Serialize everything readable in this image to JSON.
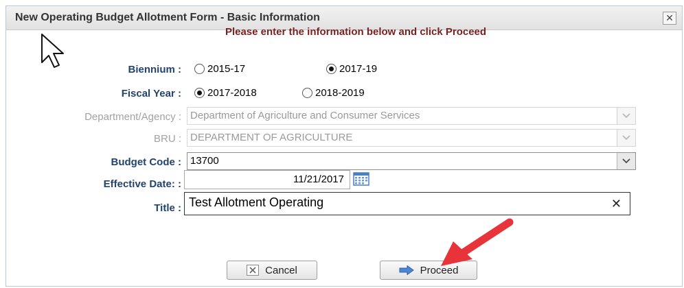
{
  "dialog": {
    "title": "New Operating Budget Allotment Form - Basic Information",
    "close_glyph": "✕",
    "instruction": "Please enter the information below and click Proceed"
  },
  "biennium": {
    "label": "Biennium :",
    "options": [
      {
        "label": "2015-17",
        "selected": false
      },
      {
        "label": "2017-19",
        "selected": true
      }
    ]
  },
  "fiscal_year": {
    "label": "Fiscal Year :",
    "options": [
      {
        "label": "2017-2018",
        "selected": true
      },
      {
        "label": "2018-2019",
        "selected": false
      }
    ]
  },
  "department": {
    "label": "Department/Agency :",
    "value": "Department of Agriculture and Consumer Services"
  },
  "bru": {
    "label": "BRU :",
    "value": "DEPARTMENT OF AGRICULTURE"
  },
  "budget_code": {
    "label": "Budget Code :",
    "value": "13700"
  },
  "effective_date": {
    "label": "Effective Date: :",
    "value": "11/21/2017"
  },
  "title_field": {
    "label": "Title :",
    "value": "Test Allotment Operating",
    "clear_glyph": "✕"
  },
  "buttons": {
    "cancel": "Cancel",
    "proceed": "Proceed"
  },
  "colors": {
    "label": "#22436e",
    "instruction": "#7a1e1e",
    "annotation_arrow": "#e8333a"
  }
}
